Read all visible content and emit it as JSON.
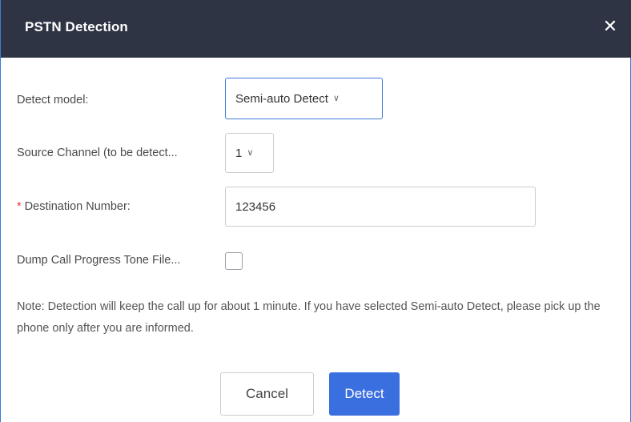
{
  "dialog": {
    "title": "PSTN Detection",
    "close_glyph": "✕"
  },
  "form": {
    "detect_model": {
      "label": "Detect model:",
      "selected": "Semi-auto Detect"
    },
    "source_channel": {
      "label": "Source Channel (to be detect...",
      "selected": "1"
    },
    "destination_number": {
      "required_mark": "*",
      "label": "Destination Number:",
      "value": "123456"
    },
    "dump_tone_file": {
      "label": "Dump Call Progress Tone File...",
      "checked": false
    },
    "note": "Note: Detection will keep the call up for about 1 minute. If you have selected Semi-auto Detect, please pick up the phone only after you are informed."
  },
  "buttons": {
    "cancel": "Cancel",
    "detect": "Detect"
  },
  "icons": {
    "chevron": "∨"
  },
  "colors": {
    "titlebar": "#2e3444",
    "accent": "#3a6fe0",
    "required": "#e53935"
  }
}
